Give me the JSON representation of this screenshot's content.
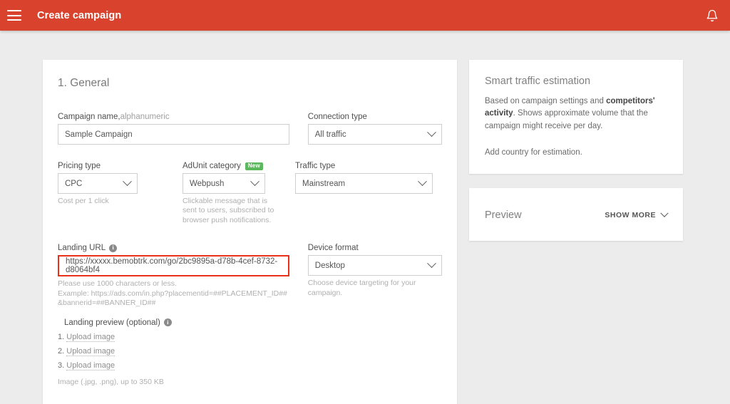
{
  "topbar": {
    "menu_icon": "hamburger-menu-icon",
    "title": "Create campaign",
    "notification_icon": "bell-icon",
    "background_color": "#d9422d"
  },
  "form": {
    "section_title": "1. General",
    "campaign_name": {
      "label": "Campaign name,",
      "label_muted": " alphanumeric",
      "value": "Sample Campaign"
    },
    "connection_type": {
      "label": "Connection type",
      "value": "All traffic"
    },
    "pricing_type": {
      "label": "Pricing type",
      "value": "CPC",
      "hint": "Cost per 1 click"
    },
    "adunit_category": {
      "label": "AdUnit category",
      "badge": "New",
      "badge_color": "#5cb85c",
      "value": "Webpush",
      "hint": "Clickable message that is sent to users, subscribed to browser push notifications."
    },
    "traffic_type": {
      "label": "Traffic type",
      "value": "Mainstream"
    },
    "landing_url": {
      "label": "Landing URL",
      "info_icon": "info-icon",
      "value": "https://xxxxx.bemobtrk.com/go/2bc9895a-d78b-4cef-8732-d8064bf4",
      "error_border_color": "#e8301a",
      "hint_line1": "Please use 1000 characters or less.",
      "hint_line2": "Example: https://ads.com/in.php?placementid=##PLACEMENT_ID##",
      "hint_line3": "&bannerid=##BANNER_ID##"
    },
    "device_format": {
      "label": "Device format",
      "value": "Desktop",
      "hint": "Choose device targeting for your campaign."
    },
    "landing_preview": {
      "label": "Landing preview (optional)",
      "info_icon": "info-icon",
      "items": [
        {
          "num": "1.",
          "link": "Upload image"
        },
        {
          "num": "2.",
          "link": "Upload image"
        },
        {
          "num": "3.",
          "link": "Upload image"
        }
      ],
      "hint": "Image (.jpg, .png), up to 350 KB"
    }
  },
  "sidebar": {
    "estimation": {
      "title": "Smart traffic estimation",
      "text_part1": "Based on campaign settings and ",
      "text_bold": "competitors' activity",
      "text_part2": ". Shows approximate volume that the campaign might receive per day.",
      "note": "Add country for estimation."
    },
    "preview": {
      "title": "Preview",
      "show_more": "SHOW MORE",
      "chevron_icon": "chevron-down-icon"
    }
  }
}
